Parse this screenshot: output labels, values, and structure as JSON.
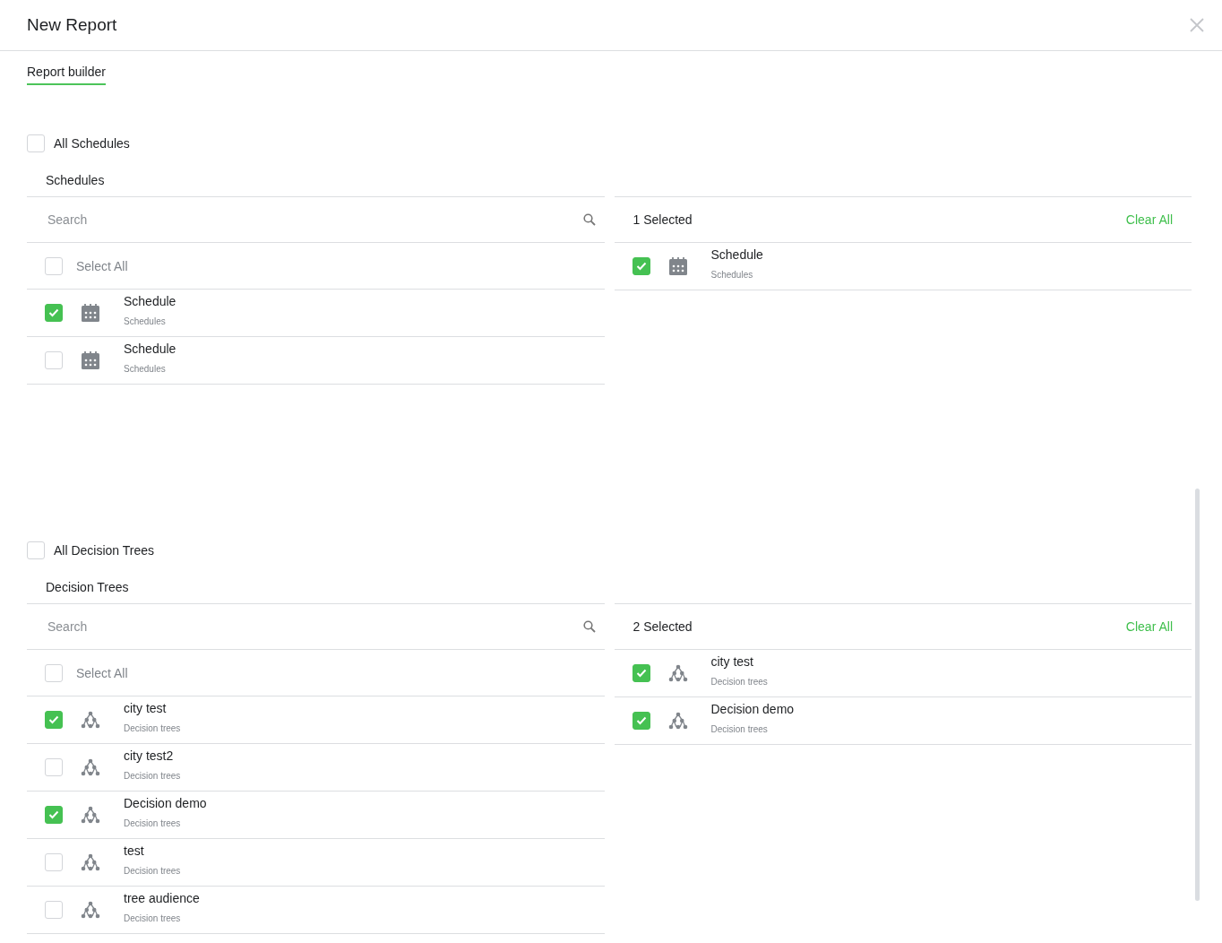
{
  "window": {
    "title": "New Report"
  },
  "tabs": [
    {
      "label": "Report builder",
      "selected": true
    }
  ],
  "sections": [
    {
      "all": {
        "label": "All Schedules",
        "checked": false
      },
      "title": "Schedules",
      "search": {
        "placeholder": "Search"
      },
      "select_all": {
        "label": "Select All",
        "checked": false
      },
      "items": [
        {
          "kind": "calendar",
          "name": "Schedule",
          "type": "Schedules",
          "checked": true
        },
        {
          "kind": "calendar",
          "name": "Schedule",
          "type": "Schedules",
          "checked": false
        }
      ],
      "selected_count": "1 Selected",
      "clear": "Clear All",
      "selected": [
        {
          "kind": "calendar",
          "name": "Schedule",
          "type": "Schedules",
          "checked": true
        }
      ]
    },
    {
      "all": {
        "label": "All Decision Trees",
        "checked": false
      },
      "title": "Decision Trees",
      "search": {
        "placeholder": "Search"
      },
      "select_all": {
        "label": "Select All",
        "checked": false
      },
      "items": [
        {
          "kind": "tree",
          "name": "city test",
          "type": "Decision trees",
          "checked": true
        },
        {
          "kind": "tree",
          "name": "city test2",
          "type": "Decision trees",
          "checked": false
        },
        {
          "kind": "tree",
          "name": "Decision demo",
          "type": "Decision trees",
          "checked": true
        },
        {
          "kind": "tree",
          "name": "test",
          "type": "Decision trees",
          "checked": false
        },
        {
          "kind": "tree",
          "name": "tree audience",
          "type": "Decision trees",
          "checked": false
        }
      ],
      "selected_count": "2 Selected",
      "clear": "Clear All",
      "selected": [
        {
          "kind": "tree",
          "name": "city test",
          "type": "Decision trees",
          "checked": true
        },
        {
          "kind": "tree",
          "name": "Decision demo",
          "type": "Decision trees",
          "checked": true
        }
      ]
    }
  ]
}
